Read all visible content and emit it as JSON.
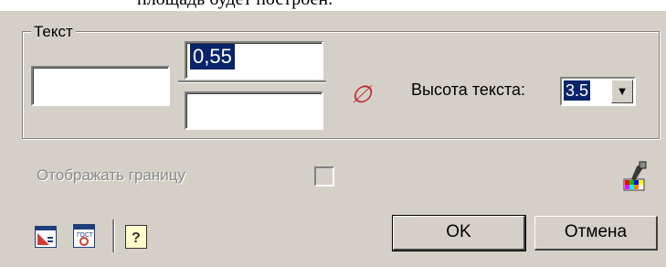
{
  "top_text": "площадь будет построен.",
  "group": {
    "title": "Текст"
  },
  "fields": {
    "left_value": "",
    "top_value": "0,55",
    "bottom_value": ""
  },
  "diameter_symbol": "∅",
  "height": {
    "label": "Высота текста:",
    "value": "3.5"
  },
  "show_border": {
    "label": "Отображать границу",
    "checked": false
  },
  "buttons": {
    "ok": "OK",
    "cancel": "Отмена"
  },
  "icons": [
    "palette-brush-icon",
    "layout-icon",
    "gost-stamp-icon",
    "help-icon"
  ]
}
